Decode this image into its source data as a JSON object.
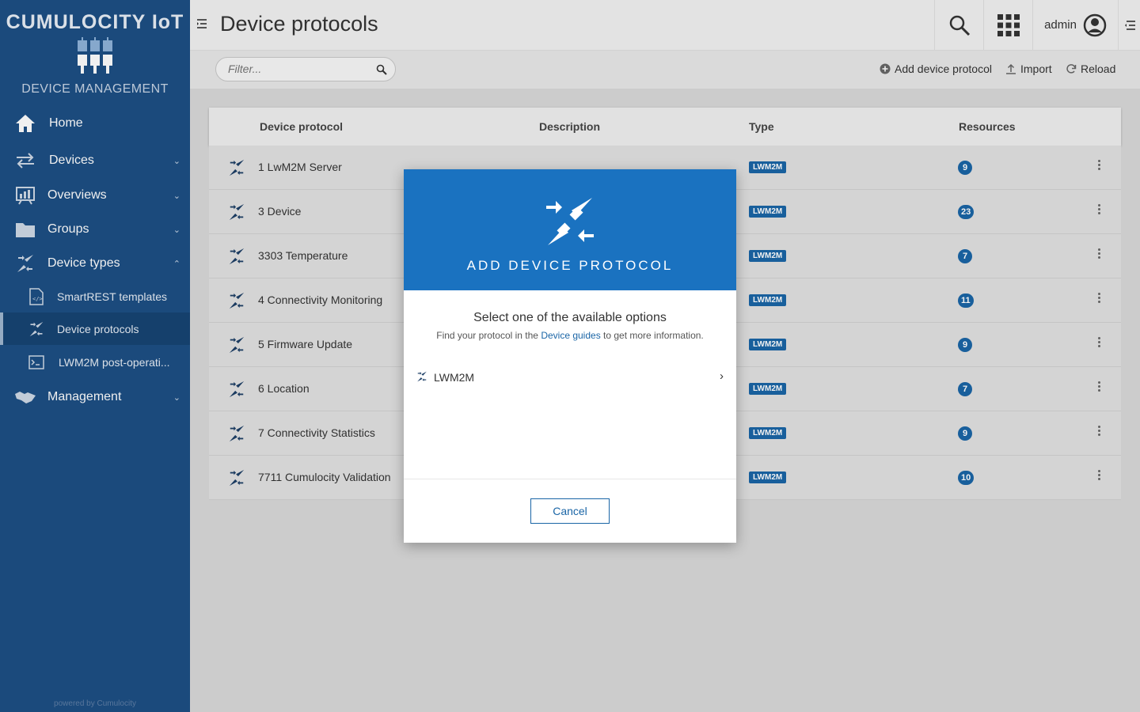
{
  "brand": {
    "title": "CUMULOCITY IoT",
    "subtitle": "DEVICE MANAGEMENT",
    "powered_by": "powered by Cumulocity"
  },
  "sidebar": {
    "items": [
      {
        "label": "Home",
        "icon": "home-icon"
      },
      {
        "label": "Devices",
        "icon": "arrows-exchange-icon"
      },
      {
        "label": "Overviews",
        "icon": "dashboard-icon"
      },
      {
        "label": "Groups",
        "icon": "folder-icon"
      },
      {
        "label": "Device types",
        "icon": "plug-icon"
      },
      {
        "label": "Management",
        "icon": "handshake-icon"
      }
    ],
    "sub_items": [
      {
        "label": "SmartREST templates",
        "icon": "code-file-icon"
      },
      {
        "label": "Device protocols",
        "icon": "plug-icon",
        "active": true
      },
      {
        "label": "LWM2M post-operati...",
        "icon": "terminal-icon"
      }
    ]
  },
  "header": {
    "title": "Device protocols",
    "user": "admin"
  },
  "actions": {
    "filter_placeholder": "Filter...",
    "add": "Add device protocol",
    "import": "Import",
    "reload": "Reload"
  },
  "table": {
    "columns": [
      "Device protocol",
      "Description",
      "Type",
      "Resources"
    ],
    "rows": [
      {
        "name": "1 LwM2M Server",
        "type": "LWM2M",
        "resources": "9"
      },
      {
        "name": "3 Device",
        "type": "LWM2M",
        "resources": "23"
      },
      {
        "name": "3303 Temperature",
        "type": "LWM2M",
        "resources": "7"
      },
      {
        "name": "4 Connectivity Monitoring",
        "type": "LWM2M",
        "resources": "11"
      },
      {
        "name": "5 Firmware Update",
        "type": "LWM2M",
        "resources": "9"
      },
      {
        "name": "6 Location",
        "type": "LWM2M",
        "resources": "7"
      },
      {
        "name": "7 Connectivity Statistics",
        "type": "LWM2M",
        "resources": "9"
      },
      {
        "name": "7711 Cumulocity Validation",
        "type": "LWM2M",
        "resources": "10"
      }
    ]
  },
  "modal": {
    "title": "ADD DEVICE PROTOCOL",
    "subtitle": "Select one of the available options",
    "hint_prefix": "Find your protocol in the ",
    "hint_link": "Device guides",
    "hint_suffix": " to get more information.",
    "option": "LWM2M",
    "cancel": "Cancel"
  },
  "colors": {
    "sidebar": "#1d4f84",
    "accent": "#1a72c0",
    "badge": "#1a65a6"
  }
}
